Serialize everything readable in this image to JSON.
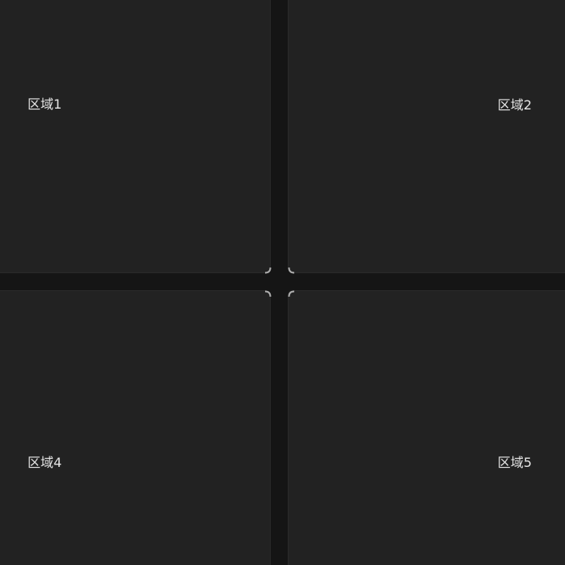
{
  "regions": [
    {
      "label": "区域1"
    },
    {
      "label": "区域2"
    },
    {
      "label": "区域4"
    },
    {
      "label": "区域5"
    }
  ],
  "colors": {
    "background": "#151515",
    "panel": "#222222",
    "text": "#e6e6e6",
    "highlight": "#bdbdbd"
  }
}
